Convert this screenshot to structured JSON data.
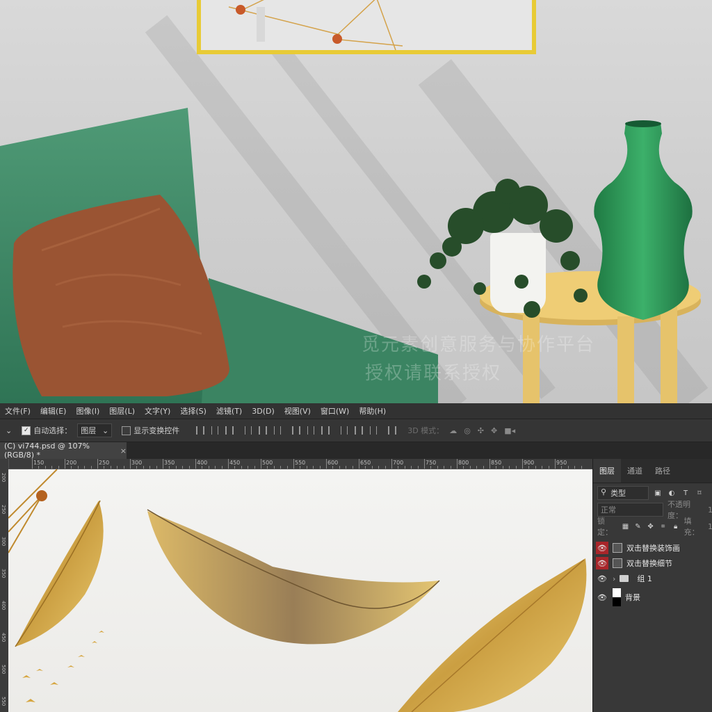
{
  "colors": {
    "frame": "#e8cb36",
    "armchair": "#3f8a66",
    "pillow": "#9a5433",
    "vase": "#2e9a5a",
    "table": "#efcd75",
    "eye_highlight": "#a8262a"
  },
  "photo": {
    "watermark_line1": "觅元素创意服务与协作平台",
    "watermark_line2": "授权请联系授权"
  },
  "menu": [
    "文件(F)",
    "编辑(E)",
    "图像(I)",
    "图层(L)",
    "文字(Y)",
    "选择(S)",
    "滤镜(T)",
    "3D(D)",
    "视图(V)",
    "窗口(W)",
    "帮助(H)"
  ],
  "options": {
    "auto_select_label": "自动选择：",
    "auto_select_value": "图层",
    "show_transform_label": "显示变换控件",
    "mode_3d_label": "3D 模式："
  },
  "document_tab": {
    "title": "(C) vi744.psd @ 107%(RGB/8) *",
    "close": "×"
  },
  "ruler": {
    "h_labels": [
      "150",
      "200",
      "250",
      "300",
      "350",
      "400",
      "450",
      "500",
      "550",
      "600",
      "650",
      "700",
      "750",
      "800",
      "850",
      "900",
      "950"
    ],
    "v_labels": [
      "200",
      "250",
      "300",
      "350",
      "400",
      "450",
      "500",
      "550"
    ]
  },
  "layers_panel": {
    "tabs": [
      "图层",
      "通道",
      "路径"
    ],
    "filter_label": "类型",
    "blend_mode": "正常",
    "opacity_label": "不透明度：",
    "opacity_value": "1",
    "lock_label": "锁定：",
    "fill_label": "填充：",
    "fill_value": "1",
    "layers": [
      {
        "name": "双击替换装饰画",
        "type": "smart-object",
        "eye_highlight": true
      },
      {
        "name": "双击替换细节",
        "type": "smart-object",
        "eye_highlight": true
      },
      {
        "name": "组 1",
        "type": "group",
        "eye_highlight": false
      },
      {
        "name": "背景",
        "type": "background",
        "eye_highlight": false
      }
    ]
  }
}
